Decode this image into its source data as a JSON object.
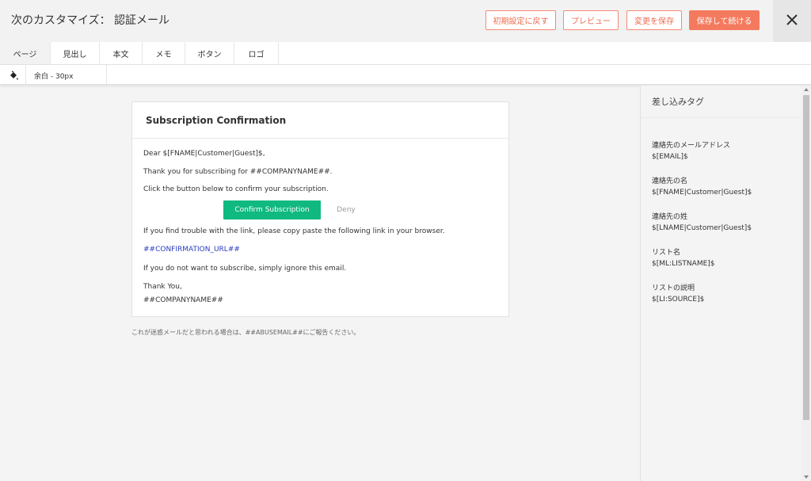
{
  "header": {
    "title": "次のカスタマイズ： 認証メール",
    "reset_label": "初期設定に戻す",
    "preview_label": "プレビュー",
    "save_label": "変更を保存",
    "save_continue_label": "保存して続ける",
    "close_icon": "close-icon"
  },
  "tabs": [
    {
      "label": "ページ",
      "active": true
    },
    {
      "label": "見出し",
      "active": false
    },
    {
      "label": "本文",
      "active": false
    },
    {
      "label": "メモ",
      "active": false
    },
    {
      "label": "ボタン",
      "active": false
    },
    {
      "label": "ロゴ",
      "active": false
    }
  ],
  "options": {
    "fill_icon": "paint-bucket-icon",
    "padding_label": "余白 - 30px"
  },
  "email": {
    "title": "Subscription Confirmation",
    "greeting": "Dear $[FNAME|Customer|Guest]$,",
    "thanks_line": "Thank you for subscribing for ##COMPANYNAME##.",
    "instruction": "Click the button below to confirm your subscription.",
    "confirm_label": "Confirm Subscription",
    "deny_label": "Deny",
    "trouble_line": "If you find trouble with the link, please copy paste the following link in your browser.",
    "confirmation_url": "##CONFIRMATION_URL##",
    "ignore_line": "If you do not want to subscribe, simply ignore this email.",
    "signoff": "Thank You,",
    "company": "##COMPANYNAME##",
    "abuse_note": "これが迷惑メールだと思われる場合は、##ABUSEMAIL##にご報告ください。"
  },
  "merge_tags": {
    "title": "差し込みタグ",
    "items": [
      {
        "label": "連絡先のメールアドレス",
        "value": "$[EMAIL]$"
      },
      {
        "label": "連絡先の名",
        "value": "$[FNAME|Customer|Guest]$"
      },
      {
        "label": "連絡先の姓",
        "value": "$[LNAME|Customer|Guest]$"
      },
      {
        "label": "リスト名",
        "value": "$[ML:LISTNAME]$"
      },
      {
        "label": "リストの説明",
        "value": "$[LI:SOURCE]$"
      }
    ]
  },
  "colors": {
    "accent": "#f47a5e",
    "confirm_button": "#10b97f",
    "link": "#2a3bbf"
  }
}
